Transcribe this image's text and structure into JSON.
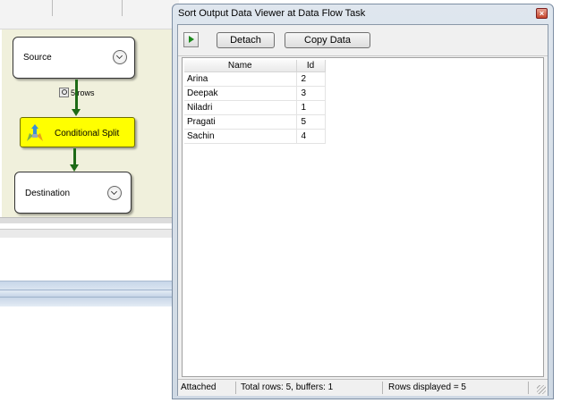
{
  "designer": {
    "nodes": {
      "source": "Source",
      "conditional_split": "Conditional Split",
      "destination": "Destination"
    },
    "path_label": "5 rows"
  },
  "viewer": {
    "title": "Sort Output Data Viewer at Data Flow Task",
    "toolbar": {
      "detach_label": "Detach",
      "copy_label": "Copy Data"
    },
    "grid": {
      "columns": [
        "Name",
        "Id"
      ],
      "rows": [
        [
          "Arina",
          "2"
        ],
        [
          "Deepak",
          "3"
        ],
        [
          "Niladri",
          "1"
        ],
        [
          "Pragati",
          "5"
        ],
        [
          "Sachin",
          "4"
        ]
      ]
    },
    "status": {
      "state": "Attached",
      "totals": "Total rows: 5, buffers: 1",
      "displayed": "Rows displayed = 5"
    }
  },
  "colors": {
    "canvas": "#f0f0dc",
    "split_fill": "#ffff00",
    "path_green": "#1e6a16",
    "close_red": "#c6452b"
  },
  "icons": [
    "play-icon",
    "close-icon",
    "chevron-down-icon",
    "data-viewer-icon",
    "conditional-split-icon"
  ]
}
